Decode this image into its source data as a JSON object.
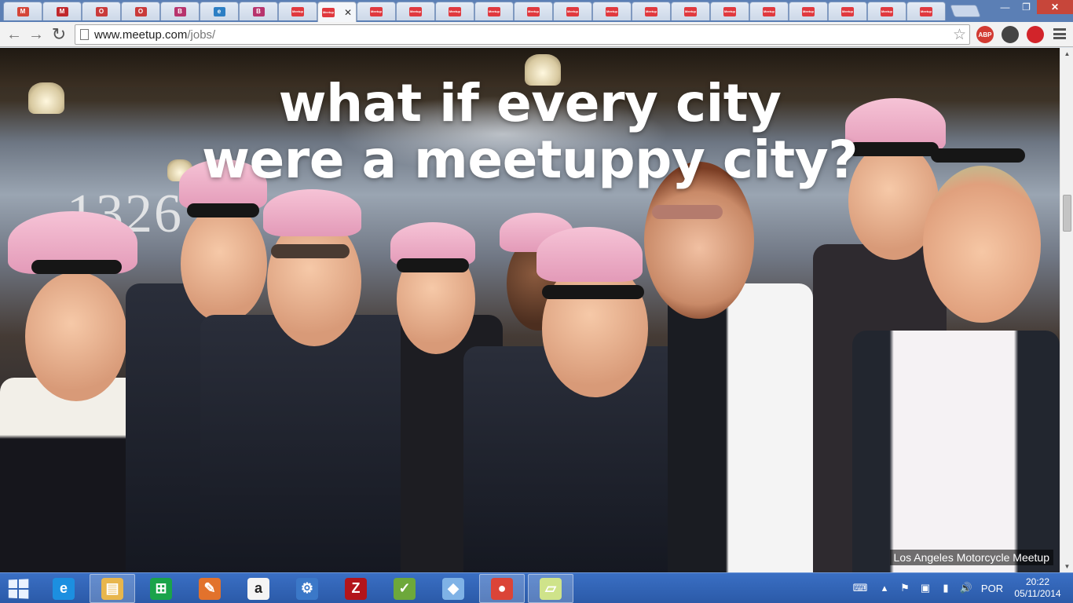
{
  "browser": {
    "tabs": [
      {
        "favicon": "gmail-icon",
        "label": "M",
        "color": "#d44638"
      },
      {
        "favicon": "gmail-icon",
        "label": "M",
        "color": "#c0282c"
      },
      {
        "favicon": "opera-red-icon",
        "label": "O",
        "color": "#c93a3a"
      },
      {
        "favicon": "opera-red-icon",
        "label": "O",
        "color": "#c93a3a"
      },
      {
        "favicon": "b-icon",
        "label": "B",
        "color": "#b7346d"
      },
      {
        "favicon": "globe-icon",
        "label": "e",
        "color": "#2d7fc4"
      },
      {
        "favicon": "b-icon",
        "label": "B",
        "color": "#b7346d"
      },
      {
        "favicon": "meetup-icon",
        "label": "Meetup",
        "color": "#e0393e"
      },
      {
        "favicon": "meetup-icon",
        "label": "Meetup",
        "color": "#e0393e",
        "active": true
      },
      {
        "favicon": "meetup-icon",
        "label": "Meetup",
        "color": "#e0393e"
      },
      {
        "favicon": "meetup-icon",
        "label": "Meetup",
        "color": "#e0393e"
      },
      {
        "favicon": "meetup-icon",
        "label": "Meetup",
        "color": "#e0393e"
      },
      {
        "favicon": "meetup-icon",
        "label": "Meetup",
        "color": "#e0393e"
      },
      {
        "favicon": "meetup-icon",
        "label": "Meetup",
        "color": "#e0393e"
      },
      {
        "favicon": "meetup-icon",
        "label": "Meetup",
        "color": "#e0393e"
      },
      {
        "favicon": "meetup-icon",
        "label": "Meetup",
        "color": "#e0393e"
      },
      {
        "favicon": "meetup-icon",
        "label": "Meetup",
        "color": "#e0393e"
      },
      {
        "favicon": "meetup-icon",
        "label": "Meetup",
        "color": "#e0393e"
      },
      {
        "favicon": "meetup-icon",
        "label": "Meetup",
        "color": "#e0393e"
      },
      {
        "favicon": "meetup-icon",
        "label": "Meetup",
        "color": "#e0393e"
      },
      {
        "favicon": "meetup-icon",
        "label": "Meetup",
        "color": "#e0393e"
      },
      {
        "favicon": "meetup-icon",
        "label": "Meetup",
        "color": "#e0393e"
      },
      {
        "favicon": "meetup-icon",
        "label": "Meetup",
        "color": "#e0393e"
      },
      {
        "favicon": "meetup-icon",
        "label": "Meetup",
        "color": "#e0393e"
      }
    ],
    "url_host": "www.meetup.com",
    "url_path": "/jobs/",
    "extensions": [
      {
        "name": "adblock-plus-icon",
        "label": "ABP",
        "color": "#d23a32"
      },
      {
        "name": "puzzle-extension-icon",
        "label": "",
        "color": "#444"
      },
      {
        "name": "power-extension-icon",
        "label": "",
        "color": "#d2242a"
      }
    ]
  },
  "page": {
    "headline_line1": "what if every city",
    "headline_line2": "were a meetuppy city?",
    "photo_caption": "Los Angeles Motorcycle Meetup",
    "storefront_number": "1326"
  },
  "taskbar": {
    "apps": [
      {
        "name": "internet-explorer-icon",
        "glyph": "e",
        "color": "#1c8fe0"
      },
      {
        "name": "file-explorer-icon",
        "glyph": "▤",
        "color": "#e8b64c",
        "active": true
      },
      {
        "name": "windows-store-icon",
        "glyph": "⊞",
        "color": "#1aa34a"
      },
      {
        "name": "paint-app-icon",
        "glyph": "✎",
        "color": "#e2722c"
      },
      {
        "name": "amazon-icon",
        "glyph": "a",
        "color": "#f4f4f4"
      },
      {
        "name": "tools-app-icon",
        "glyph": "⚙",
        "color": "#3b78c8"
      },
      {
        "name": "filezilla-icon",
        "glyph": "Z",
        "color": "#b3151b"
      },
      {
        "name": "notepad-icon",
        "glyph": "✓",
        "color": "#6da83b"
      },
      {
        "name": "cube-app-icon",
        "glyph": "◆",
        "color": "#7fb2e6"
      },
      {
        "name": "chrome-icon",
        "glyph": "●",
        "color": "#db4437",
        "active": true
      },
      {
        "name": "sticky-notes-icon",
        "glyph": "▱",
        "color": "#cfe38a",
        "active": true
      }
    ],
    "language": "POR",
    "time": "20:22",
    "date": "05/11/2014"
  }
}
